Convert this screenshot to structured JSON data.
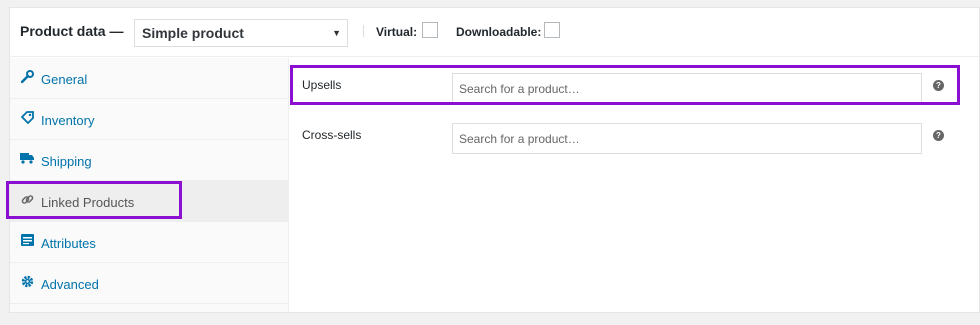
{
  "header": {
    "title": "Product data —",
    "product_type": "Simple product",
    "virtual_label": "Virtual:",
    "downloadable_label": "Downloadable:"
  },
  "tabs": [
    {
      "label": "General",
      "icon": "wrench-icon"
    },
    {
      "label": "Inventory",
      "icon": "tag-icon"
    },
    {
      "label": "Shipping",
      "icon": "truck-icon"
    },
    {
      "label": "Linked Products",
      "icon": "link-icon",
      "active": true
    },
    {
      "label": "Attributes",
      "icon": "list-icon"
    },
    {
      "label": "Advanced",
      "icon": "gear-icon"
    }
  ],
  "fields": {
    "upsells": {
      "label": "Upsells",
      "placeholder": "Search for a product…"
    },
    "cross_sells": {
      "label": "Cross-sells",
      "placeholder": "Search for a product…"
    }
  },
  "colors": {
    "highlight": "#8a0fd1",
    "link": "#0073aa"
  }
}
